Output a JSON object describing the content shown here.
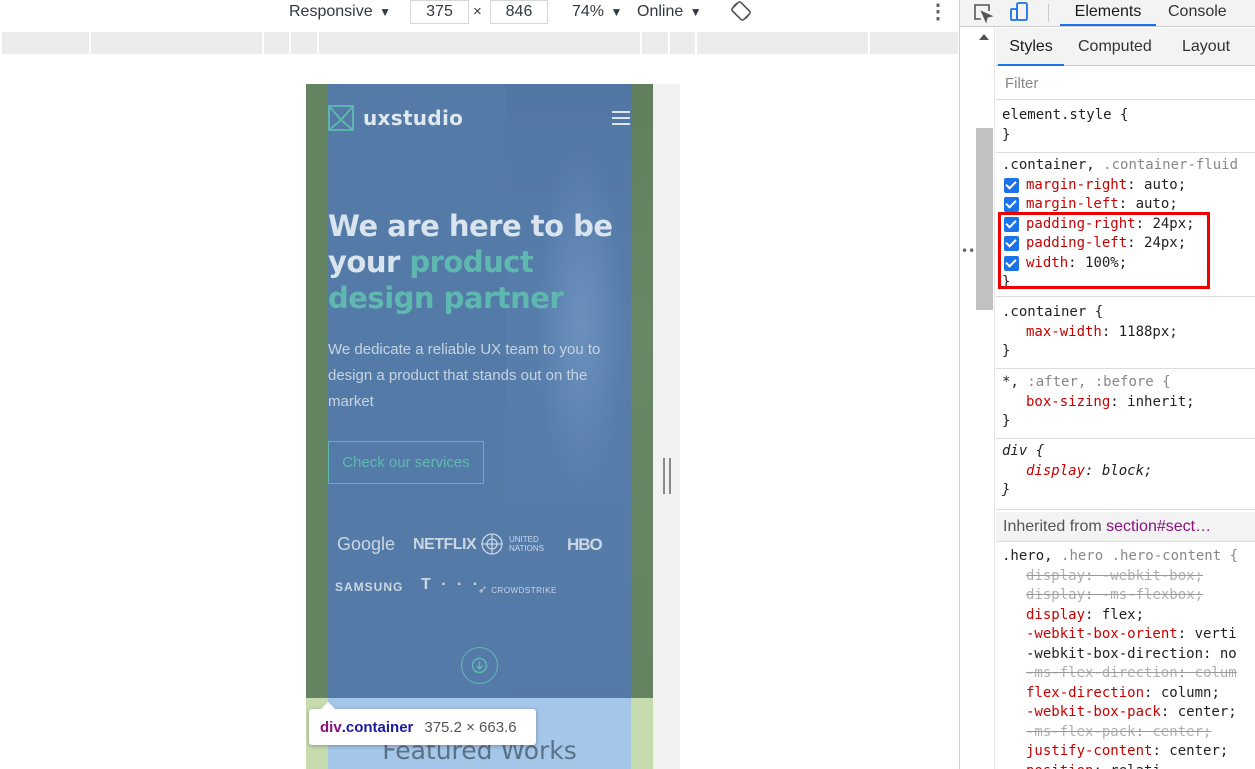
{
  "device_toolbar": {
    "device": "Responsive",
    "width": "375",
    "times": "×",
    "height": "846",
    "zoom": "74%",
    "network": "Online",
    "dropdown_arrow": "▼",
    "rotate_icon": "rotate-icon",
    "more_icon": "⋮"
  },
  "mobile_page": {
    "logo_text": "uxstudio",
    "hero_title_1": "We are here to be your ",
    "hero_title_highlight": "product design partner",
    "hero_subtitle": "We dedicate a reliable UX team to you to design a product that stands out on the market",
    "cta_label": "Check our services",
    "brands": {
      "google": "Google",
      "netflix": "NETFLIX",
      "un_line1": "UNITED",
      "un_line2": "NATIONS",
      "hbo": "HBO",
      "samsung": "SAMSUNG",
      "telekom": "T · · ·",
      "crowdstrike": "CROWDSTRIKE"
    },
    "featured_works": "Featured Works",
    "colors": {
      "accent": "#5fb8b0",
      "overlay_content": "#6ea0dc",
      "overlay_margin": "#96be6e"
    }
  },
  "overlay_tooltip": {
    "tag": "div",
    "class": ".container",
    "size": "375.2 × 663.6"
  },
  "devtools": {
    "tabs": [
      "Elements",
      "Console"
    ],
    "sub_tabs": {
      "styles": "Styles",
      "computed": "Computed",
      "layout": "Layout"
    },
    "filter_placeholder": "Filter",
    "inherited_label": "Inherited from ",
    "inherited_source": "section#sect…",
    "highlight_color": "#ee0000",
    "rules": {
      "element_style": {
        "selector": "element.style {",
        "close": "}"
      },
      "container_fluid": {
        "selector_main": ".container, ",
        "selector_dim": ".container-fluid",
        "decls": [
          {
            "name": "margin-right",
            "value": "auto;"
          },
          {
            "name": "margin-left",
            "value": "auto;"
          },
          {
            "name": "padding-right",
            "value": "24px;"
          },
          {
            "name": "padding-left",
            "value": "24px;"
          },
          {
            "name": "width",
            "value": "100%;"
          }
        ],
        "close": "}"
      },
      "container": {
        "selector": ".container {",
        "decl_name": "max-width",
        "decl_value": "1188px;",
        "close": "}"
      },
      "universal": {
        "selector_main": "*, ",
        "selector_dim": ":after, :before {",
        "decl_name": "box-sizing",
        "decl_value": "inherit;",
        "close": "}"
      },
      "div": {
        "selector": "div {",
        "decl_name": "display",
        "decl_value": "block;",
        "close": "}"
      },
      "hero": {
        "selector_main": ".hero, ",
        "selector_dim": ".hero .hero-content {",
        "decls": [
          {
            "name": "display",
            "value": "-webkit-box;"
          },
          {
            "name": "display",
            "value": "-ms-flexbox;"
          },
          {
            "name": "display",
            "value": "flex;"
          },
          {
            "name": "-webkit-box-orient",
            "value": "verti"
          },
          {
            "name": "-webkit-box-direction",
            "value": "no"
          },
          {
            "name": "-ms-flex-direction",
            "value": "colum"
          },
          {
            "name": "flex-direction",
            "value": "column;"
          },
          {
            "name": "-webkit-box-pack",
            "value": "center;"
          },
          {
            "name": "-ms-flex-pack",
            "value": "center;"
          },
          {
            "name": "justify-content",
            "value": "center;"
          },
          {
            "name": "position",
            "value": "relati"
          }
        ]
      }
    }
  }
}
